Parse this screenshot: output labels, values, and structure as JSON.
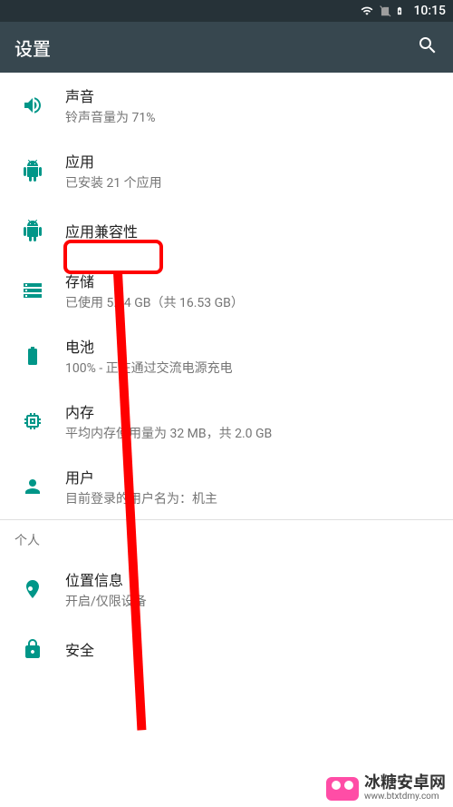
{
  "status": {
    "time": "10:15"
  },
  "appbar": {
    "title": "设置"
  },
  "rows": [
    {
      "key": "sound",
      "icon": "volume",
      "title": "声音",
      "subtitle": "铃声音量为 71%"
    },
    {
      "key": "apps",
      "icon": "android",
      "title": "应用",
      "subtitle": "已安装 21 个应用"
    },
    {
      "key": "compat",
      "icon": "android",
      "title": "应用兼容性",
      "subtitle": ""
    },
    {
      "key": "storage",
      "icon": "storage",
      "title": "存储",
      "subtitle": "已使用 5.04 GB（共 16.53 GB）"
    },
    {
      "key": "battery",
      "icon": "battery",
      "title": "电池",
      "subtitle": "100% - 正在通过交流电源充电"
    },
    {
      "key": "memory",
      "icon": "memory",
      "title": "内存",
      "subtitle": "平均内存使用量为 32 MB，共 2.0 GB"
    },
    {
      "key": "users",
      "icon": "person",
      "title": "用户",
      "subtitle": "目前登录的用户名为：机主"
    }
  ],
  "section": {
    "personal": "个人"
  },
  "rows2": [
    {
      "key": "location",
      "icon": "location",
      "title": "位置信息",
      "subtitle": "开启/仅限设备"
    },
    {
      "key": "security",
      "icon": "lock",
      "title": "安全",
      "subtitle": ""
    }
  ],
  "watermark": {
    "brand": "冰糖安卓网",
    "url": "www.btxtdmy.com"
  }
}
